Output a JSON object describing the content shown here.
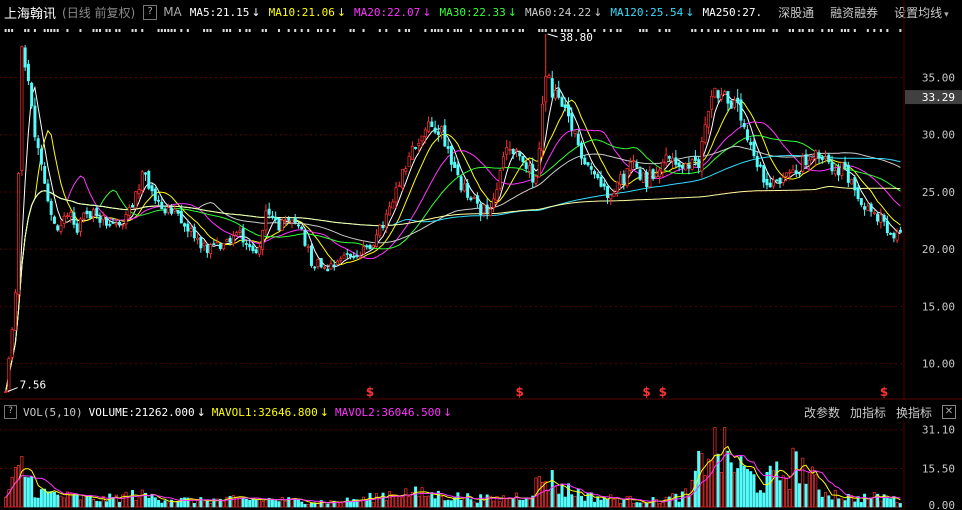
{
  "header": {
    "stock_name": "上海翰讯",
    "period_label": "(日线 前复权)",
    "help": "?",
    "ma_label": "MA",
    "ma_items": [
      {
        "label": "MA5:21.15",
        "arrow": "↓",
        "color": "#ffffff"
      },
      {
        "label": "MA10:21.06",
        "arrow": "↓",
        "color": "#ffff00"
      },
      {
        "label": "MA20:22.07",
        "arrow": "↓",
        "color": "#ff33ff"
      },
      {
        "label": "MA30:22.33",
        "arrow": "↓",
        "color": "#33ff33"
      },
      {
        "label": "MA60:24.22",
        "arrow": "↓",
        "color": "#cccccc"
      },
      {
        "label": "MA120:25.54",
        "arrow": "↓",
        "color": "#33ddff"
      },
      {
        "label": "MA250:27.",
        "arrow": "",
        "color": "#ffffff"
      }
    ],
    "menu": [
      "深股通",
      "融资融券",
      "设置均线"
    ],
    "menu_caret": "▾"
  },
  "volume_header": {
    "help": "?",
    "label": "VOL(5,10)",
    "volume": "VOLUME:21262.000",
    "volume_arrow": "↓",
    "mavol1": "MAVOL1:32646.800",
    "mavol1_arrow": "↓",
    "mavol2": "MAVOL2:36046.500",
    "mavol2_arrow": "↓",
    "buttons": [
      "改参数",
      "加指标",
      "换指标"
    ],
    "close": "✕"
  },
  "colors": {
    "up": "#ff3232",
    "down": "#54fcfc",
    "grid": "#5a0000",
    "axis_text": "#c8c8c8",
    "current_bg": "#404040"
  },
  "chart_data": [
    {
      "type": "candlestick",
      "title": "",
      "y_ticks": [
        "35.00",
        "30.00",
        "25.00",
        "20.00",
        "15.00",
        "10.00"
      ],
      "ylim": [
        7.0,
        39.5
      ],
      "current_price_label": "33.29",
      "current_price": 33.29,
      "annotations": [
        {
          "text": "38.80",
          "type": "max",
          "x_index": 166,
          "value": 38.8
        },
        {
          "text": "7.56",
          "type": "min",
          "x_index": 0,
          "value": 7.56
        }
      ],
      "event_markers": {
        "symbol": "$",
        "x_indices": [
          112,
          158,
          197,
          202,
          270
        ]
      },
      "n_sessions": 276,
      "close_anchors": [
        [
          0,
          7.56
        ],
        [
          3,
          16
        ],
        [
          5,
          37
        ],
        [
          7,
          34
        ],
        [
          9,
          30
        ],
        [
          11,
          27
        ],
        [
          13,
          24
        ],
        [
          16,
          21.5
        ],
        [
          19,
          23.5
        ],
        [
          22,
          22
        ],
        [
          27,
          23.5
        ],
        [
          32,
          22
        ],
        [
          37,
          22.5
        ],
        [
          42,
          26.5
        ],
        [
          47,
          24
        ],
        [
          52,
          23
        ],
        [
          57,
          21.5
        ],
        [
          62,
          20
        ],
        [
          67,
          20.5
        ],
        [
          72,
          21.5
        ],
        [
          77,
          19.5
        ],
        [
          80,
          23
        ],
        [
          85,
          22
        ],
        [
          90,
          22.5
        ],
        [
          94,
          19
        ],
        [
          99,
          18.5
        ],
        [
          104,
          19.5
        ],
        [
          109,
          19.5
        ],
        [
          114,
          21
        ],
        [
          119,
          24
        ],
        [
          124,
          28
        ],
        [
          129,
          30.5
        ],
        [
          134,
          30.5
        ],
        [
          139,
          26
        ],
        [
          144,
          24
        ],
        [
          149,
          23
        ],
        [
          154,
          29
        ],
        [
          159,
          27.5
        ],
        [
          163,
          26
        ],
        [
          166,
          35
        ],
        [
          169,
          33.5
        ],
        [
          173,
          31
        ],
        [
          177,
          28.5
        ],
        [
          181,
          26.5
        ],
        [
          185,
          25
        ],
        [
          189,
          26
        ],
        [
          193,
          27.5
        ],
        [
          197,
          26
        ],
        [
          201,
          27.5
        ],
        [
          205,
          28
        ],
        [
          209,
          27
        ],
        [
          213,
          27.5
        ],
        [
          217,
          34
        ],
        [
          221,
          33.5
        ],
        [
          225,
          32
        ],
        [
          229,
          28.5
        ],
        [
          233,
          26
        ],
        [
          237,
          26
        ],
        [
          241,
          26.5
        ],
        [
          245,
          27.5
        ],
        [
          249,
          28
        ],
        [
          253,
          27.5
        ],
        [
          257,
          27
        ],
        [
          261,
          25.5
        ],
        [
          265,
          23.5
        ],
        [
          269,
          22.5
        ],
        [
          272,
          21
        ],
        [
          275,
          21.15
        ]
      ],
      "ma_lines": [
        {
          "name": "MA5",
          "color": "#ffffff",
          "last": 21.15
        },
        {
          "name": "MA10",
          "color": "#ffff00",
          "last": 21.06
        },
        {
          "name": "MA20",
          "color": "#ff33ff",
          "last": 22.07
        },
        {
          "name": "MA30",
          "color": "#33ff33",
          "last": 22.33
        },
        {
          "name": "MA60",
          "color": "#cccccc",
          "last": 24.22
        },
        {
          "name": "MA120",
          "color": "#33ddff",
          "last": 25.54
        },
        {
          "name": "MA250",
          "color": "#ffffa0",
          "last": 27.0
        }
      ]
    },
    {
      "type": "bar",
      "title": "",
      "y_ticks": [
        "31.10",
        "15.50",
        "0.00"
      ],
      "ylim": [
        0,
        33
      ],
      "volume_anchors": [
        [
          0,
          4
        ],
        [
          5,
          16
        ],
        [
          10,
          6
        ],
        [
          20,
          4
        ],
        [
          30,
          3
        ],
        [
          40,
          5
        ],
        [
          50,
          3
        ],
        [
          60,
          2.5
        ],
        [
          70,
          3
        ],
        [
          80,
          3
        ],
        [
          90,
          2.5
        ],
        [
          100,
          2
        ],
        [
          110,
          3
        ],
        [
          120,
          6
        ],
        [
          130,
          5
        ],
        [
          140,
          4
        ],
        [
          150,
          3
        ],
        [
          160,
          5
        ],
        [
          166,
          12
        ],
        [
          172,
          7
        ],
        [
          180,
          4
        ],
        [
          190,
          3
        ],
        [
          200,
          2.5
        ],
        [
          210,
          5
        ],
        [
          216,
          25
        ],
        [
          220,
          22
        ],
        [
          226,
          15
        ],
        [
          232,
          9
        ],
        [
          240,
          14
        ],
        [
          244,
          18
        ],
        [
          250,
          7
        ],
        [
          260,
          3.5
        ],
        [
          270,
          4
        ],
        [
          275,
          2.5
        ]
      ],
      "series": [
        {
          "name": "VOLUME",
          "last": 21262.0
        },
        {
          "name": "MAVOL1",
          "color": "#ffff00",
          "last": 32646.8
        },
        {
          "name": "MAVOL2",
          "color": "#ff33ff",
          "last": 36046.5
        }
      ]
    }
  ]
}
